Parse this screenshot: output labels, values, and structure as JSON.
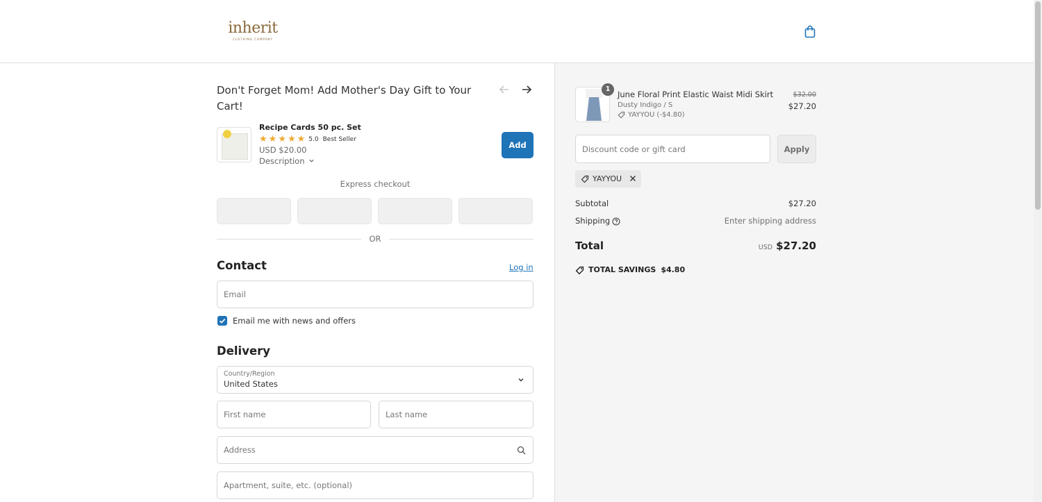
{
  "brand": {
    "name": "inherit",
    "tagline": "CLOTHING COMPANY"
  },
  "upsell": {
    "title": "Don't Forget Mom! Add Mother's Day Gift to Your Cart!",
    "prev_icon": "arrow-left-icon",
    "next_icon": "arrow-right-icon",
    "product": {
      "name": "Recipe Cards 50 pc. Set",
      "rating": "5.0",
      "stars": 5,
      "badge": "Best Seller",
      "price": "USD $20.00",
      "description_label": "Description",
      "add_label": "Add"
    }
  },
  "express": {
    "label": "Express checkout",
    "or_label": "OR"
  },
  "contact": {
    "heading": "Contact",
    "login_label": "Log in",
    "email_placeholder": "Email",
    "newsletter_label": "Email me with news and offers",
    "newsletter_checked": true
  },
  "delivery": {
    "heading": "Delivery",
    "country_label": "Country/Region",
    "country_value": "United States",
    "first_name_placeholder": "First name",
    "last_name_placeholder": "Last name",
    "address_placeholder": "Address",
    "apartment_placeholder": "Apartment, suite, etc. (optional)"
  },
  "summary": {
    "item": {
      "quantity": "1",
      "name": "June Floral Print Elastic Waist Midi Skirt",
      "variant": "Dusty Indigo / S",
      "discount": "YAYYOU (-$4.80)",
      "original_price": "$32.00",
      "price": "$27.20"
    },
    "discount_placeholder": "Discount code or gift card",
    "apply_label": "Apply",
    "applied_code": "YAYYOU",
    "subtotal_label": "Subtotal",
    "subtotal_value": "$27.20",
    "shipping_label": "Shipping",
    "shipping_value": "Enter shipping address",
    "total_label": "Total",
    "total_currency": "USD",
    "total_value": "$27.20",
    "savings_label": "TOTAL SAVINGS",
    "savings_value": "$4.80"
  },
  "colors": {
    "accent": "#1f73b7",
    "brand": "#8a6a3a",
    "star": "#f0a830",
    "panel_bg": "#f5f5f5"
  }
}
